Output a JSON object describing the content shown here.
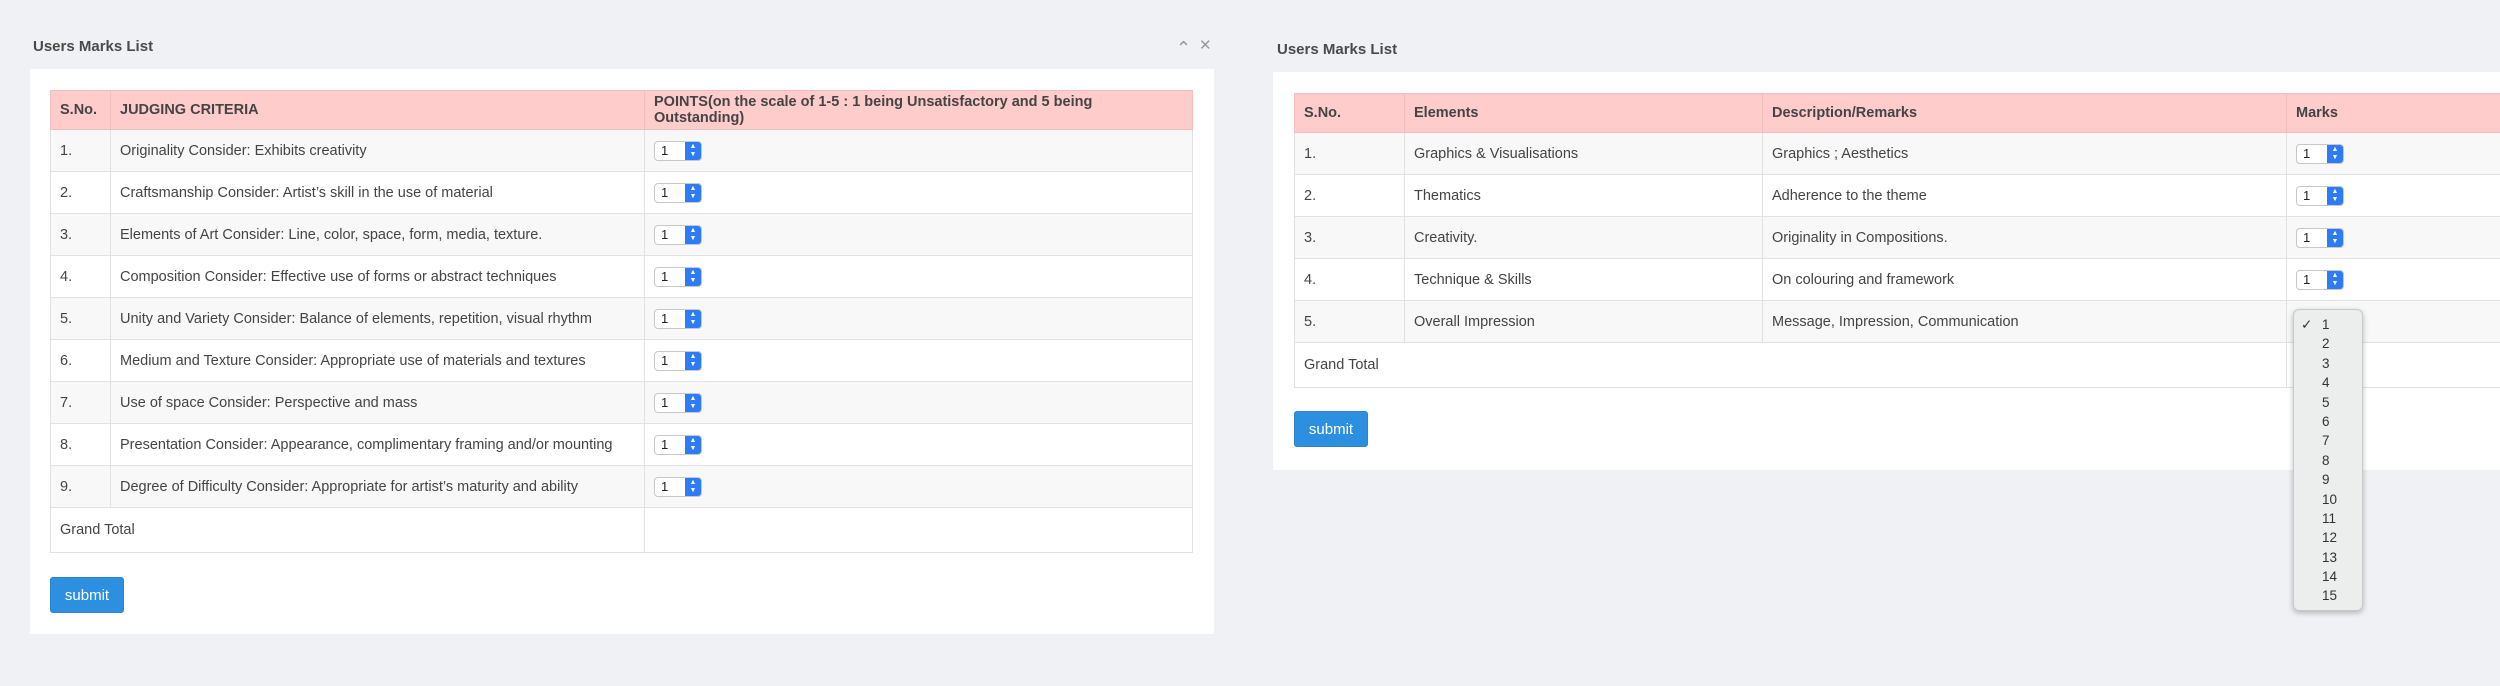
{
  "left": {
    "title": "Users Marks List",
    "controls": {
      "collapse": "⌃",
      "close": "✕"
    },
    "headers": [
      "S.No.",
      "JUDGING CRITERIA",
      "POINTS(on the scale of 1-5 : 1 being Unsatisfactory and 5 being Outstanding)"
    ],
    "rows": [
      {
        "sno": "1.",
        "criteria": "Originality Consider: Exhibits creativity",
        "points": "1"
      },
      {
        "sno": "2.",
        "criteria": "Craftsmanship Consider: Artist’s skill in the use of material",
        "points": "1"
      },
      {
        "sno": "3.",
        "criteria": "Elements of Art Consider: Line, color, space, form, media, texture.",
        "points": "1"
      },
      {
        "sno": "4.",
        "criteria": "Composition Consider: Effective use of forms or abstract techniques",
        "points": "1"
      },
      {
        "sno": "5.",
        "criteria": "Unity and Variety Consider: Balance of elements, repetition, visual rhythm",
        "points": "1"
      },
      {
        "sno": "6.",
        "criteria": "Medium and Texture Consider: Appropriate use of materials and textures",
        "points": "1"
      },
      {
        "sno": "7.",
        "criteria": "Use of space Consider: Perspective and mass",
        "points": "1"
      },
      {
        "sno": "8.",
        "criteria": "Presentation Consider: Appearance, complimentary framing and/or mounting",
        "points": "1"
      },
      {
        "sno": "9.",
        "criteria": "Degree of Difficulty Consider: Appropriate for artist’s maturity and ability",
        "points": "1"
      }
    ],
    "grand_total": "Grand Total",
    "submit": "submit"
  },
  "right": {
    "title": "Users Marks List",
    "headers": [
      "S.No.",
      "Elements",
      "Description/Remarks",
      "Marks"
    ],
    "rows": [
      {
        "sno": "1.",
        "element": "Graphics & Visualisations",
        "desc": "Graphics ; Aesthetics",
        "marks": "1"
      },
      {
        "sno": "2.",
        "element": "Thematics",
        "desc": "Adherence to the theme",
        "marks": "1"
      },
      {
        "sno": "3.",
        "element": "Creativity.",
        "desc": "Originality in Compositions.",
        "marks": "1"
      },
      {
        "sno": "4.",
        "element": "Technique & Skills",
        "desc": "On colouring and framework",
        "marks": "1"
      },
      {
        "sno": "5.",
        "element": "Overall Impression",
        "desc": "Message, Impression, Communication",
        "marks": "1"
      }
    ],
    "grand_total": "Grand Total",
    "submit": "submit",
    "dropdown": {
      "checkmark": "✓",
      "options": [
        "1",
        "2",
        "3",
        "4",
        "5",
        "6",
        "7",
        "8",
        "9",
        "10",
        "11",
        "12",
        "13",
        "14",
        "15"
      ],
      "selected": "1"
    }
  },
  "select_arrow": "▲▼"
}
